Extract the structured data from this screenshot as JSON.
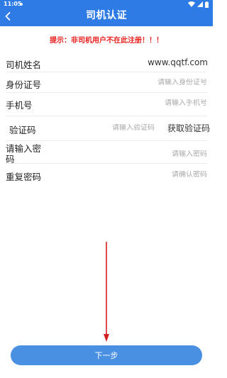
{
  "status_bar": {
    "time": "11:05"
  },
  "header": {
    "title": "司机认证"
  },
  "tip": "提示：非司机用户不在此注册！！！",
  "fields": {
    "name": {
      "label": "司机姓名",
      "value": "www.qqtf.com"
    },
    "id_card": {
      "label": "身份证号",
      "placeholder": "请输入身份证号"
    },
    "phone": {
      "label": "手机号",
      "placeholder": "请输入手机号"
    },
    "code": {
      "label": "验证码",
      "placeholder": "请输入验证码",
      "button": "获取验证码"
    },
    "password": {
      "label": "请输入密码",
      "placeholder": "请输入密码"
    },
    "confirm_password": {
      "label": "重复密码",
      "placeholder": "请确认密码"
    }
  },
  "next_button": {
    "label": "下一步"
  },
  "colors": {
    "header_bg": "#2e7be6",
    "tip": "#e8201e",
    "button_bg": "#4a90e2",
    "arrow": "#d42020"
  }
}
